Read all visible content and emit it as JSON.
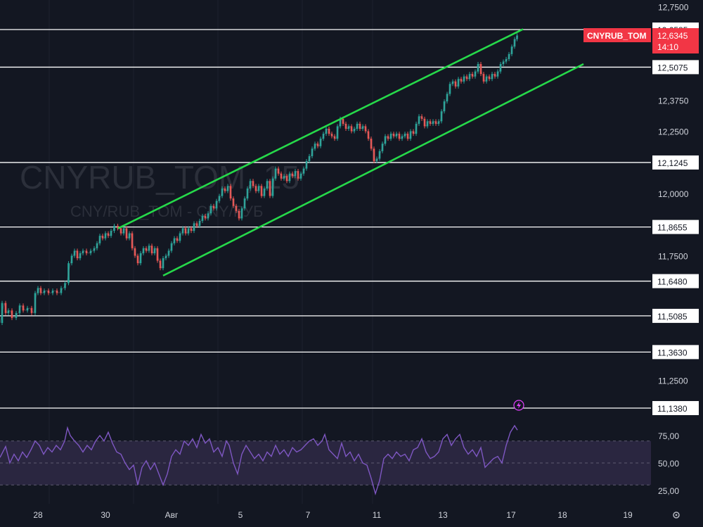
{
  "colors": {
    "background": "#131722",
    "grid": "#1e222d",
    "axis_text": "#d1d4dc",
    "hline": "#ffffff",
    "channel": "#26d94a",
    "candle_up": "#26a69a",
    "candle_down": "#ef5350",
    "price_badge": "#f23645",
    "rsi_line": "#7e57c2",
    "rsi_band": "#2a2640",
    "watermark": "#2b2f3a",
    "alert_icon": "#e040fb"
  },
  "watermark": {
    "symbol": "CNYRUB_TOM, 15",
    "description": "CNY/RUB_TOM - CNY/РУБ"
  },
  "price_badge": {
    "symbol": "CNYRUB_TOM",
    "price": "12,6345",
    "countdown": "14:10"
  },
  "alert_icon": "lightning-alert-icon",
  "settings_icon": "gear-icon",
  "chart_data": {
    "type": "line",
    "candles_note_series": "CNYRUB_TOM",
    "y_axis_ticks": [
      "12,7500",
      "12,3750",
      "12,2500",
      "12,0000",
      "11,7500",
      "11,2500"
    ],
    "y_range": [
      11.05,
      12.8
    ],
    "x_ticks": [
      "28",
      "30",
      "Авг",
      "5",
      "7",
      "11",
      "13",
      "17",
      "18",
      "19"
    ],
    "horizontal_levels": [
      "12,6585",
      "12,5075",
      "12,1245",
      "11,8655",
      "11,6480",
      "11,5085",
      "11,3630",
      "11,1380"
    ],
    "price_path": [
      [
        0,
        11.48
      ],
      [
        6,
        11.56
      ],
      [
        10,
        11.52
      ],
      [
        14,
        11.53
      ],
      [
        20,
        11.5
      ],
      [
        26,
        11.52
      ],
      [
        30,
        11.55
      ],
      [
        36,
        11.53
      ],
      [
        42,
        11.54
      ],
      [
        48,
        11.52
      ],
      [
        52,
        11.6
      ],
      [
        56,
        11.62
      ],
      [
        60,
        11.6
      ],
      [
        66,
        11.61
      ],
      [
        72,
        11.6
      ],
      [
        78,
        11.61
      ],
      [
        84,
        11.6
      ],
      [
        90,
        11.62
      ],
      [
        95,
        11.64
      ],
      [
        100,
        11.72
      ],
      [
        104,
        11.75
      ],
      [
        108,
        11.77
      ],
      [
        112,
        11.74
      ],
      [
        116,
        11.76
      ],
      [
        120,
        11.77
      ],
      [
        126,
        11.76
      ],
      [
        132,
        11.77
      ],
      [
        136,
        11.78
      ],
      [
        140,
        11.8
      ],
      [
        144,
        11.83
      ],
      [
        148,
        11.82
      ],
      [
        152,
        11.84
      ],
      [
        156,
        11.83
      ],
      [
        160,
        11.85
      ],
      [
        165,
        11.87
      ],
      [
        170,
        11.86
      ],
      [
        174,
        11.84
      ],
      [
        178,
        11.86
      ],
      [
        182,
        11.82
      ],
      [
        186,
        11.84
      ],
      [
        190,
        11.78
      ],
      [
        194,
        11.75
      ],
      [
        198,
        11.72
      ],
      [
        202,
        11.76
      ],
      [
        206,
        11.78
      ],
      [
        210,
        11.77
      ],
      [
        214,
        11.79
      ],
      [
        218,
        11.76
      ],
      [
        222,
        11.78
      ],
      [
        226,
        11.73
      ],
      [
        230,
        11.7
      ],
      [
        234,
        11.74
      ],
      [
        238,
        11.75
      ],
      [
        242,
        11.77
      ],
      [
        246,
        11.8
      ],
      [
        250,
        11.82
      ],
      [
        254,
        11.81
      ],
      [
        258,
        11.84
      ],
      [
        262,
        11.86
      ],
      [
        266,
        11.84
      ],
      [
        270,
        11.86
      ],
      [
        274,
        11.85
      ],
      [
        278,
        11.88
      ],
      [
        282,
        11.87
      ],
      [
        286,
        11.89
      ],
      [
        290,
        11.91
      ],
      [
        294,
        11.9
      ],
      [
        298,
        11.92
      ],
      [
        302,
        11.95
      ],
      [
        306,
        11.94
      ],
      [
        310,
        11.97
      ],
      [
        314,
        11.99
      ],
      [
        318,
        12.02
      ],
      [
        322,
        12.01
      ],
      [
        326,
        12.03
      ],
      [
        330,
        11.98
      ],
      [
        334,
        11.95
      ],
      [
        338,
        11.93
      ],
      [
        342,
        11.9
      ],
      [
        346,
        11.94
      ],
      [
        350,
        11.98
      ],
      [
        354,
        12.02
      ],
      [
        358,
        12.05
      ],
      [
        362,
        12.03
      ],
      [
        366,
        12.01
      ],
      [
        370,
        12.03
      ],
      [
        374,
        11.99
      ],
      [
        378,
        12.02
      ],
      [
        382,
        12.05
      ],
      [
        386,
        11.99
      ],
      [
        390,
        12.06
      ],
      [
        394,
        12.1
      ],
      [
        398,
        12.08
      ],
      [
        402,
        12.06
      ],
      [
        406,
        12.07
      ],
      [
        410,
        12.05
      ],
      [
        414,
        12.08
      ],
      [
        418,
        12.07
      ],
      [
        422,
        12.09
      ],
      [
        426,
        12.06
      ],
      [
        430,
        12.08
      ],
      [
        434,
        12.1
      ],
      [
        438,
        12.13
      ],
      [
        442,
        12.15
      ],
      [
        446,
        12.18
      ],
      [
        450,
        12.2
      ],
      [
        454,
        12.19
      ],
      [
        458,
        12.22
      ],
      [
        462,
        12.24
      ],
      [
        466,
        12.26
      ],
      [
        470,
        12.24
      ],
      [
        474,
        12.23
      ],
      [
        478,
        12.22
      ],
      [
        482,
        12.27
      ],
      [
        486,
        12.3
      ],
      [
        490,
        12.28
      ],
      [
        494,
        12.26
      ],
      [
        498,
        12.27
      ],
      [
        502,
        12.25
      ],
      [
        506,
        12.26
      ],
      [
        510,
        12.28
      ],
      [
        514,
        12.26
      ],
      [
        518,
        12.27
      ],
      [
        522,
        12.25
      ],
      [
        526,
        12.22
      ],
      [
        530,
        12.18
      ],
      [
        534,
        12.13
      ],
      [
        538,
        12.14
      ],
      [
        542,
        12.17
      ],
      [
        546,
        12.2
      ],
      [
        550,
        12.23
      ],
      [
        554,
        12.22
      ],
      [
        558,
        12.24
      ],
      [
        562,
        12.23
      ],
      [
        566,
        12.24
      ],
      [
        570,
        12.22
      ],
      [
        574,
        12.23
      ],
      [
        578,
        12.24
      ],
      [
        582,
        12.22
      ],
      [
        586,
        12.25
      ],
      [
        590,
        12.24
      ],
      [
        594,
        12.28
      ],
      [
        598,
        12.31
      ],
      [
        602,
        12.3
      ],
      [
        606,
        12.27
      ],
      [
        610,
        12.29
      ],
      [
        614,
        12.28
      ],
      [
        618,
        12.29
      ],
      [
        622,
        12.28
      ],
      [
        626,
        12.29
      ],
      [
        630,
        12.33
      ],
      [
        634,
        12.37
      ],
      [
        638,
        12.4
      ],
      [
        642,
        12.44
      ],
      [
        646,
        12.45
      ],
      [
        650,
        12.43
      ],
      [
        654,
        12.46
      ],
      [
        658,
        12.45
      ],
      [
        662,
        12.47
      ],
      [
        666,
        12.46
      ],
      [
        670,
        12.48
      ],
      [
        674,
        12.47
      ],
      [
        678,
        12.49
      ],
      [
        682,
        12.52
      ],
      [
        686,
        12.48
      ],
      [
        690,
        12.45
      ],
      [
        694,
        12.47
      ],
      [
        698,
        12.46
      ],
      [
        702,
        12.48
      ],
      [
        706,
        12.47
      ],
      [
        710,
        12.49
      ],
      [
        714,
        12.52
      ],
      [
        718,
        12.53
      ],
      [
        722,
        12.54
      ],
      [
        726,
        12.56
      ],
      [
        730,
        12.59
      ],
      [
        734,
        12.62
      ],
      [
        737,
        12.6345
      ]
    ],
    "channel_upper": [
      [
        168,
        11.86
      ],
      [
        744,
        12.66
      ]
    ],
    "channel_lower": [
      [
        232,
        11.67
      ],
      [
        830,
        12.52
      ]
    ],
    "rsi": {
      "ticks": [
        "75,00",
        "50,00",
        "25,00"
      ],
      "y_range": [
        15,
        90
      ],
      "band": [
        30,
        70
      ],
      "values": [
        [
          0,
          55
        ],
        [
          8,
          65
        ],
        [
          14,
          50
        ],
        [
          20,
          58
        ],
        [
          26,
          52
        ],
        [
          32,
          60
        ],
        [
          38,
          55
        ],
        [
          44,
          62
        ],
        [
          50,
          70
        ],
        [
          56,
          66
        ],
        [
          62,
          58
        ],
        [
          68,
          64
        ],
        [
          74,
          60
        ],
        [
          80,
          66
        ],
        [
          86,
          62
        ],
        [
          92,
          70
        ],
        [
          96,
          82
        ],
        [
          100,
          75
        ],
        [
          106,
          70
        ],
        [
          112,
          66
        ],
        [
          118,
          60
        ],
        [
          124,
          66
        ],
        [
          130,
          62
        ],
        [
          136,
          70
        ],
        [
          142,
          75
        ],
        [
          148,
          70
        ],
        [
          154,
          78
        ],
        [
          160,
          68
        ],
        [
          166,
          60
        ],
        [
          172,
          58
        ],
        [
          178,
          50
        ],
        [
          184,
          44
        ],
        [
          190,
          48
        ],
        [
          196,
          30
        ],
        [
          202,
          46
        ],
        [
          208,
          52
        ],
        [
          214,
          44
        ],
        [
          220,
          50
        ],
        [
          226,
          40
        ],
        [
          232,
          30
        ],
        [
          238,
          40
        ],
        [
          244,
          56
        ],
        [
          250,
          62
        ],
        [
          256,
          58
        ],
        [
          262,
          70
        ],
        [
          268,
          66
        ],
        [
          274,
          72
        ],
        [
          280,
          64
        ],
        [
          286,
          76
        ],
        [
          292,
          68
        ],
        [
          298,
          72
        ],
        [
          304,
          60
        ],
        [
          310,
          64
        ],
        [
          316,
          56
        ],
        [
          322,
          70
        ],
        [
          326,
          66
        ],
        [
          332,
          50
        ],
        [
          338,
          40
        ],
        [
          344,
          58
        ],
        [
          350,
          66
        ],
        [
          356,
          60
        ],
        [
          362,
          54
        ],
        [
          368,
          58
        ],
        [
          374,
          52
        ],
        [
          380,
          60
        ],
        [
          386,
          56
        ],
        [
          392,
          66
        ],
        [
          398,
          58
        ],
        [
          404,
          62
        ],
        [
          410,
          56
        ],
        [
          416,
          64
        ],
        [
          422,
          60
        ],
        [
          428,
          62
        ],
        [
          434,
          66
        ],
        [
          440,
          70
        ],
        [
          446,
          72
        ],
        [
          452,
          66
        ],
        [
          458,
          70
        ],
        [
          462,
          76
        ],
        [
          468,
          62
        ],
        [
          474,
          58
        ],
        [
          480,
          54
        ],
        [
          486,
          68
        ],
        [
          492,
          56
        ],
        [
          498,
          60
        ],
        [
          504,
          52
        ],
        [
          510,
          58
        ],
        [
          516,
          50
        ],
        [
          522,
          48
        ],
        [
          528,
          36
        ],
        [
          534,
          22
        ],
        [
          540,
          34
        ],
        [
          546,
          54
        ],
        [
          552,
          58
        ],
        [
          558,
          54
        ],
        [
          564,
          60
        ],
        [
          570,
          56
        ],
        [
          576,
          58
        ],
        [
          582,
          52
        ],
        [
          588,
          62
        ],
        [
          594,
          64
        ],
        [
          600,
          72
        ],
        [
          606,
          60
        ],
        [
          612,
          54
        ],
        [
          618,
          56
        ],
        [
          624,
          60
        ],
        [
          630,
          72
        ],
        [
          636,
          76
        ],
        [
          642,
          66
        ],
        [
          648,
          72
        ],
        [
          654,
          76
        ],
        [
          660,
          64
        ],
        [
          666,
          58
        ],
        [
          672,
          62
        ],
        [
          678,
          56
        ],
        [
          684,
          64
        ],
        [
          690,
          46
        ],
        [
          696,
          50
        ],
        [
          702,
          54
        ],
        [
          708,
          56
        ],
        [
          714,
          50
        ],
        [
          720,
          66
        ],
        [
          726,
          78
        ],
        [
          732,
          84
        ],
        [
          736,
          80
        ]
      ]
    }
  }
}
